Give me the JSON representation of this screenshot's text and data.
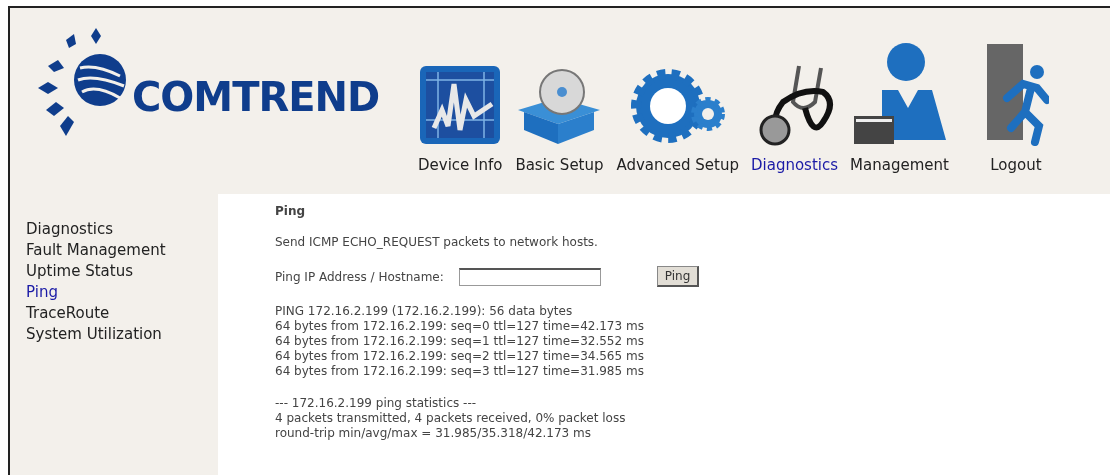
{
  "logo": {
    "text": "COMTREND"
  },
  "nav": [
    {
      "label": "Device Info",
      "kind": "chart",
      "selected": false
    },
    {
      "label": "Basic Setup",
      "kind": "box",
      "selected": false
    },
    {
      "label": "Advanced Setup",
      "kind": "gears",
      "selected": false
    },
    {
      "label": "Diagnostics",
      "kind": "stethoscope",
      "selected": true
    },
    {
      "label": "Management",
      "kind": "person",
      "selected": false
    },
    {
      "label": "Logout",
      "kind": "exit",
      "selected": false
    }
  ],
  "sidebar": {
    "items": [
      {
        "label": "Diagnostics",
        "selected": false
      },
      {
        "label": "Fault Management",
        "selected": false
      },
      {
        "label": "Uptime Status",
        "selected": false
      },
      {
        "label": "Ping",
        "selected": true
      },
      {
        "label": "TraceRoute",
        "selected": false
      },
      {
        "label": "System Utilization",
        "selected": false
      }
    ]
  },
  "content": {
    "title": "Ping",
    "description": "Send ICMP ECHO_REQUEST packets to network hosts.",
    "field_label": "Ping IP Address / Hostname:",
    "button": "Ping",
    "output": [
      [
        "PING 172.16.2.199 (172.16.2.199): 56 data bytes",
        "64 bytes from 172.16.2.199: seq=0 ttl=127 time=42.173 ms",
        "64 bytes from 172.16.2.199: seq=1 ttl=127 time=32.552 ms",
        "64 bytes from 172.16.2.199: seq=2 ttl=127 time=34.565 ms",
        "64 bytes from 172.16.2.199: seq=3 ttl=127 time=31.985 ms"
      ],
      [
        "--- 172.16.2.199 ping statistics ---",
        "4 packets transmitted, 4 packets received, 0% packet loss",
        "round-trip min/avg/max = 31.985/35.318/42.173 ms"
      ]
    ]
  }
}
